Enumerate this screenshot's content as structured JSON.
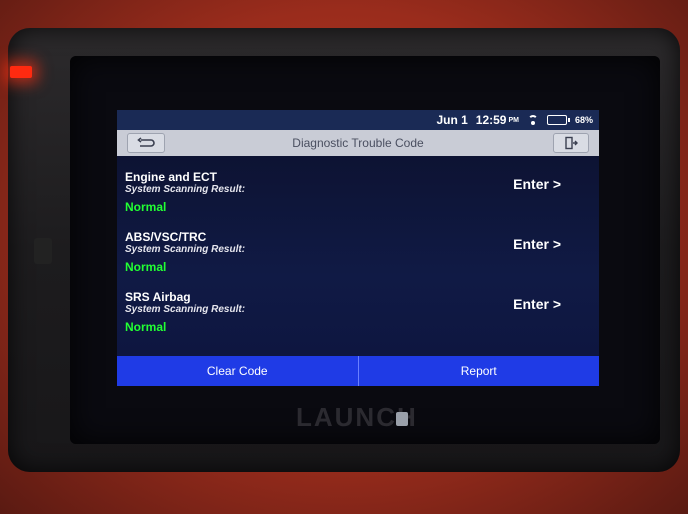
{
  "status": {
    "date": "Jun 1",
    "time": "12:59",
    "ampm": "PM",
    "battery": "68%",
    "battery_level": 0.68,
    "wifi_icon": "wifi-icon",
    "battery_icon": "battery-icon"
  },
  "titlebar": {
    "title": "Diagnostic Trouble Code",
    "back_icon": "back-arrow-icon",
    "exit_icon": "exit-icon"
  },
  "systems": [
    {
      "name": "Engine and ECT",
      "subtitle": "System Scanning Result:",
      "result": "Normal",
      "action": "Enter >"
    },
    {
      "name": "ABS/VSC/TRC",
      "subtitle": "System Scanning Result:",
      "result": "Normal",
      "action": "Enter >"
    },
    {
      "name": "SRS Airbag",
      "subtitle": "System Scanning Result:",
      "result": "Normal",
      "action": "Enter >"
    }
  ],
  "bottombar": {
    "clear_label": "Clear Code",
    "report_label": "Report"
  },
  "device": {
    "brand": "LAUNCH"
  },
  "colors": {
    "result_green": "#22ff33",
    "action_blue": "#1f3be6",
    "titlebar_gray": "#c9ccd6"
  }
}
